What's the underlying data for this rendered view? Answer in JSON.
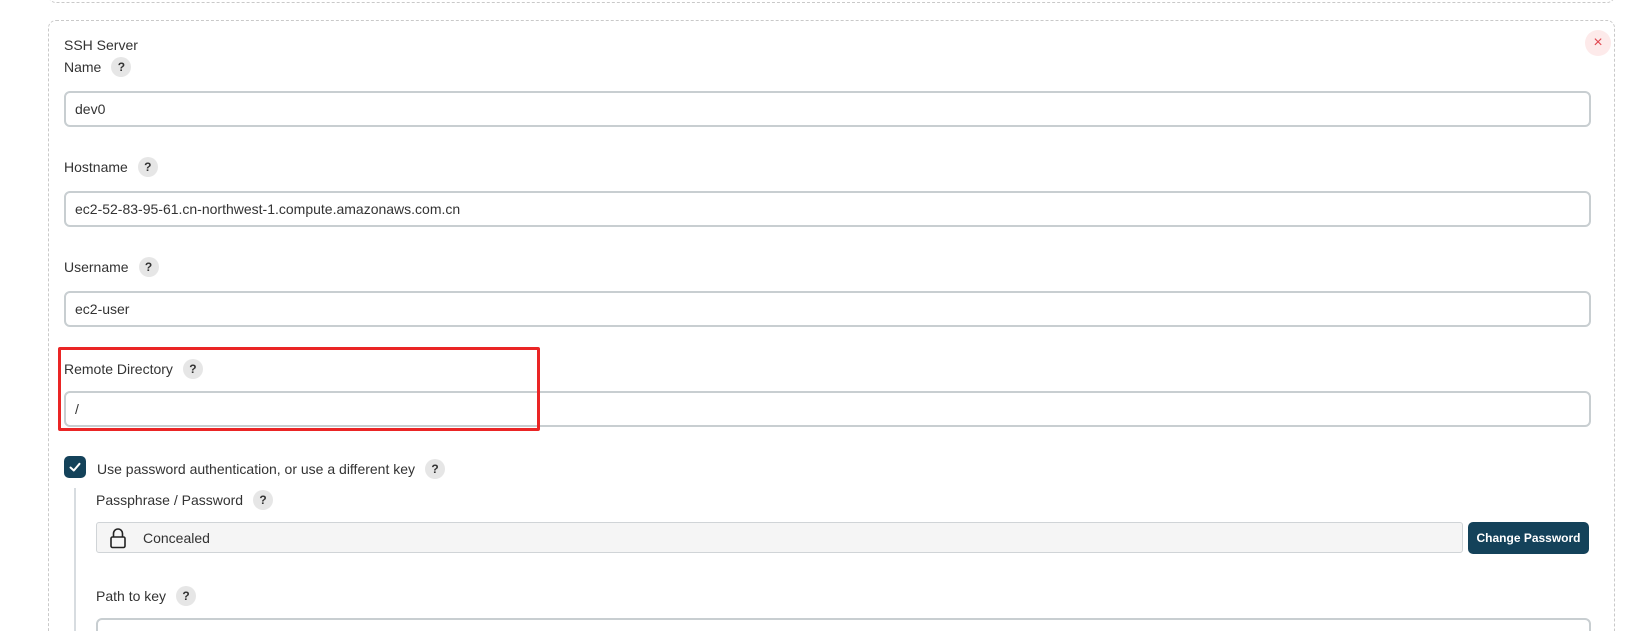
{
  "server": {
    "section_title": "SSH Server",
    "close_symbol": "×",
    "help_symbol": "?",
    "name": {
      "label": "Name",
      "value": "dev0"
    },
    "hostname": {
      "label": "Hostname",
      "value": "ec2-52-83-95-61.cn-northwest-1.compute.amazonaws.com.cn"
    },
    "username": {
      "label": "Username",
      "value": "ec2-user"
    },
    "remote_directory": {
      "label": "Remote Directory",
      "value": "/"
    },
    "password_auth": {
      "label": "Use password authentication, or use a different key",
      "checked": true
    },
    "passphrase": {
      "label": "Passphrase / Password",
      "value": "Concealed",
      "button_label": "Change Password"
    },
    "path_to_key": {
      "label": "Path to key",
      "value": ""
    }
  },
  "colors": {
    "accent": "#14425a",
    "highlight": "#ea2525",
    "close": "#e0464f"
  },
  "icons": {
    "close": "close-icon",
    "help": "help-icon",
    "check": "check-icon",
    "lock": "lock-icon"
  }
}
